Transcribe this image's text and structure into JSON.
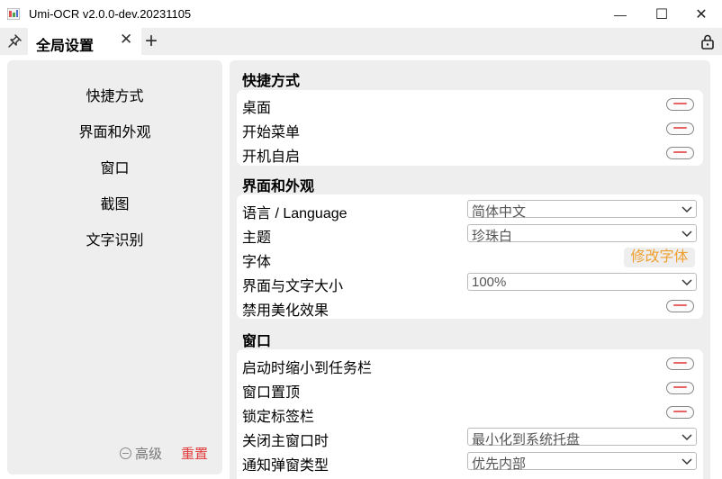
{
  "window": {
    "title": "Umi-OCR v2.0.0-dev.20231105",
    "minimize_glyph": "—",
    "maximize_glyph": "☐",
    "close_glyph": "✕"
  },
  "tabs": {
    "pin_icon": "pin-icon",
    "active_tab_label": "全局设置",
    "close_glyph": "✕",
    "add_glyph": "+",
    "lock_icon": "lock-icon"
  },
  "sidebar": {
    "items": [
      {
        "label": "快捷方式"
      },
      {
        "label": "界面和外观"
      },
      {
        "label": "窗口"
      },
      {
        "label": "截图"
      },
      {
        "label": "文字识别"
      }
    ],
    "advanced_label": "高级",
    "reset_label": "重置"
  },
  "sections": {
    "shortcuts": {
      "title": "快捷方式",
      "rows": [
        {
          "label": "桌面",
          "enabled": false
        },
        {
          "label": "开始菜单",
          "enabled": false
        },
        {
          "label": "开机自启",
          "enabled": false
        }
      ]
    },
    "appearance": {
      "title": "界面和外观",
      "language": {
        "label": "语言 / Language",
        "value": "简体中文"
      },
      "theme": {
        "label": "主题",
        "value": "珍珠白"
      },
      "font": {
        "label": "字体",
        "button": "修改字体"
      },
      "scale": {
        "label": "界面与文字大小",
        "value": "100%"
      },
      "effects": {
        "label": "禁用美化效果",
        "enabled": false
      }
    },
    "window": {
      "title": "窗口",
      "minimize_start": {
        "label": "启动时缩小到任务栏",
        "enabled": false
      },
      "topmost": {
        "label": "窗口置顶",
        "enabled": false
      },
      "lock_tabs": {
        "label": "锁定标签栏",
        "enabled": false
      },
      "close_action": {
        "label": "关闭主窗口时",
        "value": "最小化到系统托盘"
      },
      "notify_type": {
        "label": "通知弹窗类型",
        "value": "优先内部"
      }
    }
  },
  "colors": {
    "toggle_off_mark": "#e86464",
    "reset_red": "#e23b3b",
    "font_button_text": "#f0a030",
    "panel_bg": "#eeeeee"
  }
}
